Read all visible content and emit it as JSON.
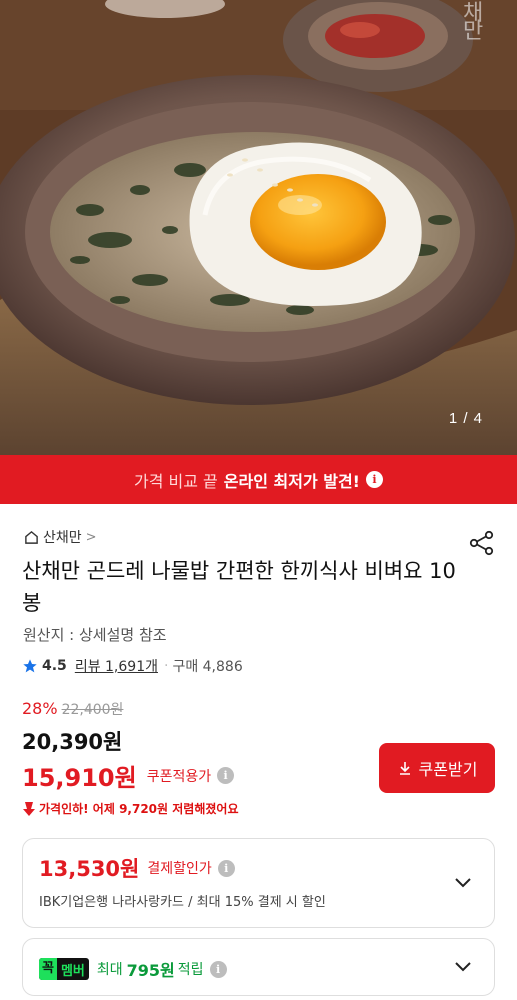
{
  "hero": {
    "image_alt": "나물밥 위 계란 프라이",
    "watermark": "채만",
    "counter": "1 / 4"
  },
  "banner": {
    "prefix": "가격 비교 끝",
    "highlight": "온라인 최저가 발견!",
    "info_icon": "info-icon"
  },
  "product": {
    "brand": "산채만",
    "brand_chevron": ">",
    "title": "산채만 곤드레 나물밥 간편한 한끼식사 비벼요 10봉",
    "origin": "원산지 : 상세설명 참조",
    "rating": "4.5",
    "review": "리뷰 1,691개",
    "separator": "·",
    "purchase": "구매 4,886"
  },
  "price": {
    "discount_rate": "28%",
    "original": "22,400원",
    "sale": "20,390원",
    "coupon_price": "15,910원",
    "coupon_label": "쿠폰적용가",
    "coupon_button": "쿠폰받기",
    "price_drop": "가격인하! 어제 9,720원 저렴해졌어요"
  },
  "payment_card": {
    "price": "13,530원",
    "label": "결제할인가",
    "detail": "IBK기업은행 나라사랑카드 / 최대 15% 결제 시 할인"
  },
  "member_card": {
    "badge_1": "꼭",
    "badge_2": "멤버",
    "max": "최대",
    "amount": "795원",
    "earn": "적립"
  },
  "colors": {
    "accent_red": "#e11b22",
    "member_green": "#1ee05b"
  }
}
